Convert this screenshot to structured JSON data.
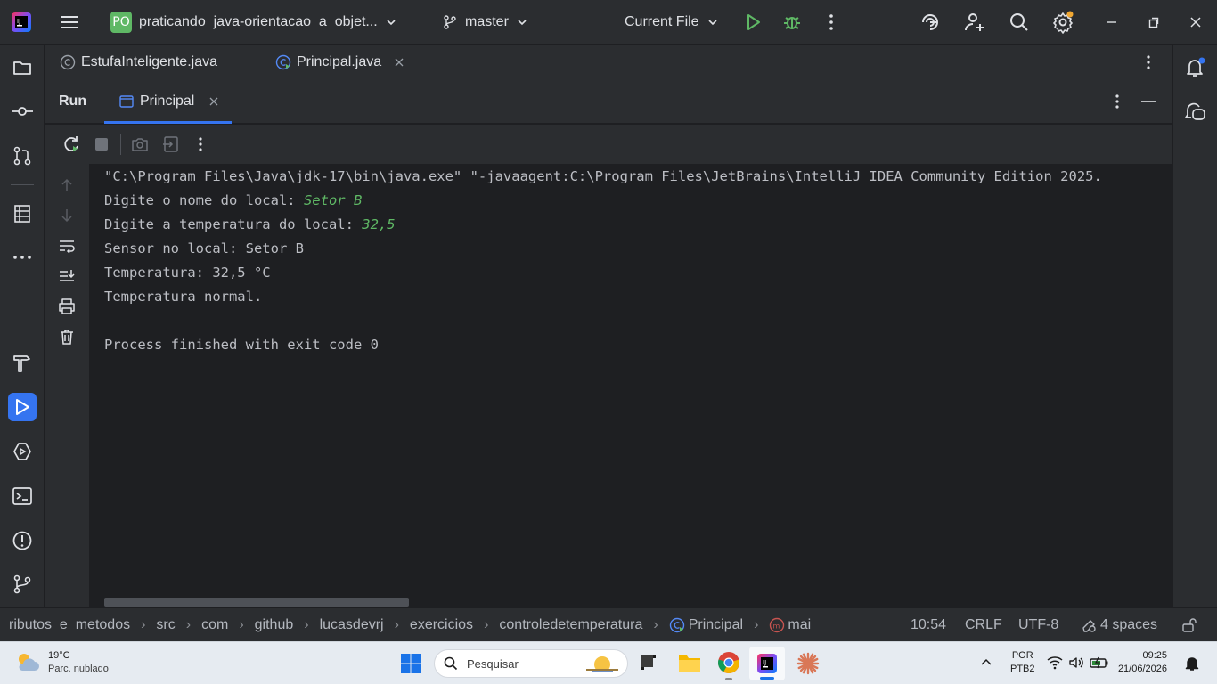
{
  "titlebar": {
    "project_badge": "PO",
    "project_name": "praticando_java-orientacao_a_objet...",
    "branch": "master",
    "run_config": "Current File"
  },
  "editor_tabs": [
    {
      "label": "EstufaInteligente.java"
    },
    {
      "label": "Principal.java"
    }
  ],
  "run_panel": {
    "title": "Run",
    "tab_label": "Principal"
  },
  "console": {
    "lines": [
      {
        "text": "\"C:\\Program Files\\Java\\jdk-17\\bin\\java.exe\" \"-javaagent:C:\\Program Files\\JetBrains\\IntelliJ IDEA Community Edition 2025.",
        "input": ""
      },
      {
        "text": "Digite o nome do local: ",
        "input": "Setor B"
      },
      {
        "text": "Digite a temperatura do local: ",
        "input": "32,5"
      },
      {
        "text": "Sensor no local: Setor B",
        "input": ""
      },
      {
        "text": "Temperatura: 32,5 °C",
        "input": ""
      },
      {
        "text": "Temperatura normal.",
        "input": ""
      },
      {
        "text": "",
        "input": ""
      },
      {
        "text": "Process finished with exit code 0",
        "input": ""
      }
    ]
  },
  "statusbar": {
    "breadcrumb": [
      "ributos_e_metodos",
      "src",
      "com",
      "github",
      "lucasdevrj",
      "exercicios",
      "controledetemperatura",
      "Principal",
      "mai"
    ],
    "position": "10:54",
    "line_ending": "CRLF",
    "encoding": "UTF-8",
    "indent": "4 spaces"
  },
  "taskbar": {
    "weather_temp": "19°C",
    "weather_desc": "Parc. nublado",
    "search_placeholder": "Pesquisar",
    "language": "POR",
    "layout": "PTB2",
    "time": "09:25",
    "date": "21/06/2026"
  },
  "colors": {
    "accent": "#3574f0",
    "run_green": "#5fb865",
    "notification_dot": "#f0a732"
  }
}
